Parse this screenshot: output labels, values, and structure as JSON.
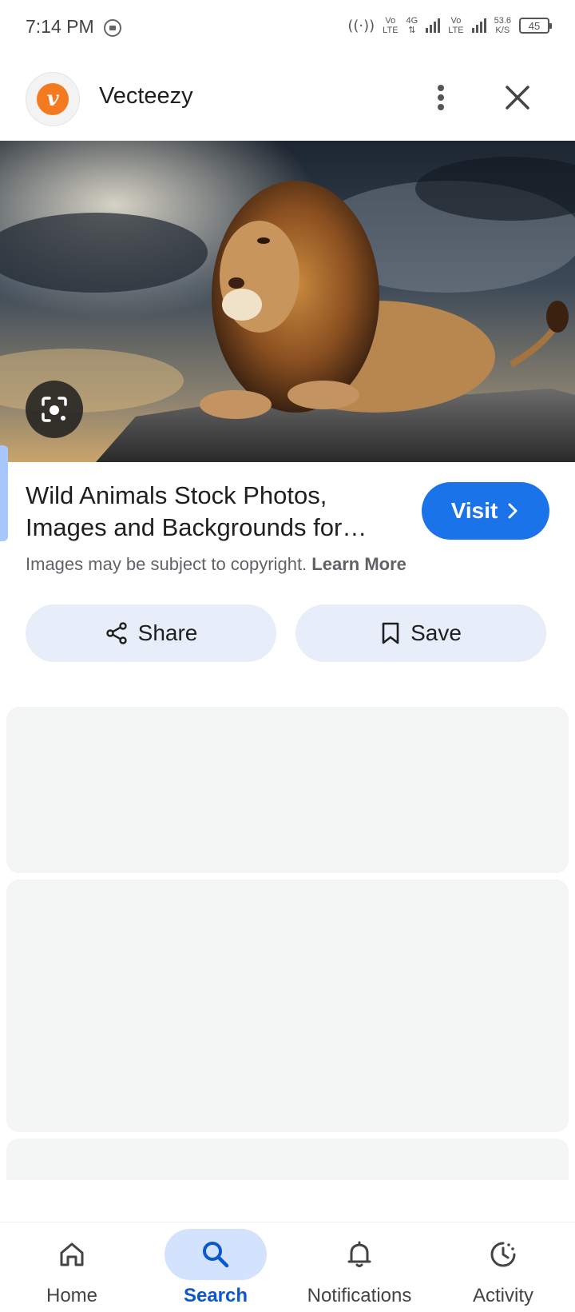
{
  "status_bar": {
    "time": "7:14 PM",
    "volte1_top": "Vo",
    "volte1_bottom": "LTE",
    "net_type": "4G",
    "volte2_top": "Vo",
    "volte2_bottom": "LTE",
    "speed_value": "53.6",
    "speed_unit": "K/S",
    "battery": "45"
  },
  "header": {
    "site_logo_letter": "v",
    "site_name": "Vecteezy"
  },
  "result": {
    "title": "Wild Animals Stock Photos, Images and Backgrounds for…",
    "visit_label": "Visit",
    "copyright_text": "Images may be subject to copyright.",
    "learn_more": "Learn More"
  },
  "actions": {
    "share_label": "Share",
    "save_label": "Save"
  },
  "bottom_nav": {
    "items": [
      {
        "label": "Home",
        "icon": "home-icon"
      },
      {
        "label": "Search",
        "icon": "search-icon",
        "active": true
      },
      {
        "label": "Notifications",
        "icon": "bell-icon"
      },
      {
        "label": "Activity",
        "icon": "activity-icon"
      }
    ]
  },
  "colors": {
    "accent": "#1a73e8",
    "active_nav_bg": "#d3e3fd",
    "active_nav_text": "#0b57d0",
    "action_button_bg": "#e8eef9",
    "logo_orange": "#f47a1f"
  }
}
